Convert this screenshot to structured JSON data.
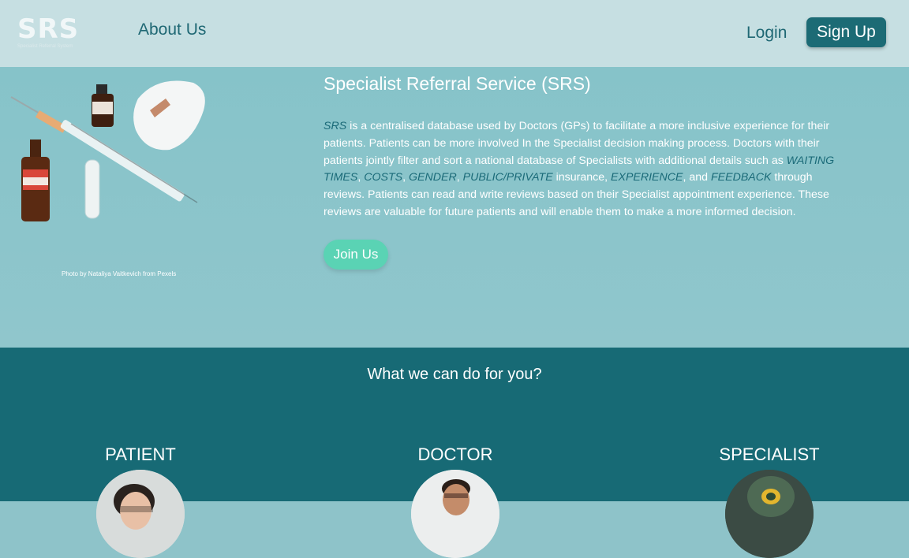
{
  "navbar": {
    "logo_text": "SRS",
    "logo_subtitle": "Specialist Referral System",
    "about_label": "About Us",
    "login_label": "Login",
    "signup_label": "Sign Up"
  },
  "hero": {
    "photo_credit": "Photo by Nataliya Vaitkevich from Pexels",
    "title": "Specialist Referral Service (SRS)",
    "desc": {
      "srs": "SRS",
      "p1": " is a centralised database used by Doctors (GPs) to facilitate a more inclusive experience for their patients. Patients can be more involved In the Specialist decision making process. Doctors with their patients jointly filter and sort a national database of Specialists with additional details such as ",
      "waiting": "WAITING TIMES",
      "sep1": ", ",
      "costs": "COSTS",
      "sep2": ", ",
      "gender": "GENDER",
      "sep3": ", ",
      "public": "PUBLIC/PRIVATE",
      "p2": " insurance, ",
      "experience": "EXPERIENCE",
      "p3": ", and ",
      "feedback": "FEEDBACK",
      "p4": " through reviews. Patients can read and write reviews based on their Specialist appointment experience. These reviews are valuable for future patients and will enable them to make a more informed decision."
    },
    "join_label": "Join Us"
  },
  "features": {
    "title": "What we can do for you?",
    "roles": [
      {
        "label": "PATIENT"
      },
      {
        "label": "DOCTOR"
      },
      {
        "label": "SPECIALIST"
      }
    ]
  },
  "colors": {
    "navbar_bg": "#c6dfe2",
    "hero_bg": "#8ec3c9",
    "brand_teal": "#1c6b75",
    "accent_green": "#5ad3b4",
    "features_bg": "#176a75"
  }
}
